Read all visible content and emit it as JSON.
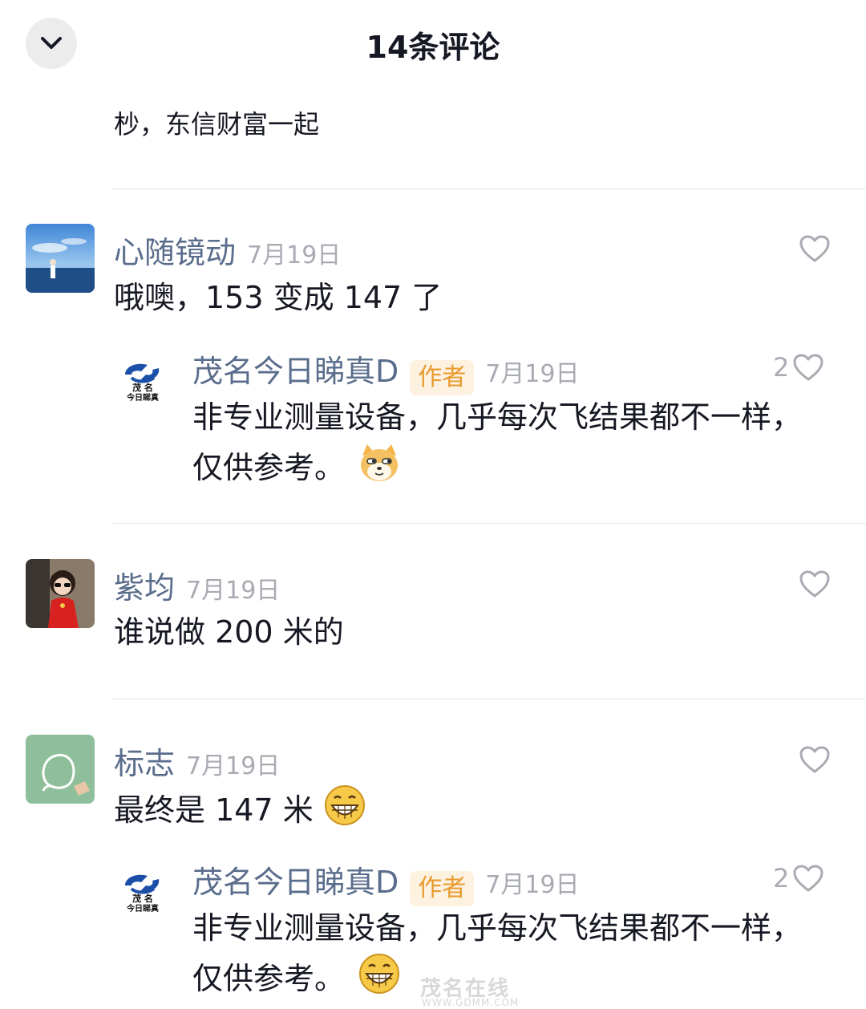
{
  "header": {
    "title": "14条评论"
  },
  "partial_comment": {
    "text": "杪，东信财富一起"
  },
  "comments": [
    {
      "name": "心随镜动",
      "date": "7月19日",
      "text": "哦噢，153 变成 147 了",
      "like_icon": "heart-outline",
      "reply": {
        "name": "茂名今日睇真D",
        "badge": "作者",
        "date": "7月19日",
        "likes": "2",
        "text_line1": "非专业测量设备，几乎每次飞结果都不一样，",
        "text_line2": "仅供参考。",
        "emoji": "doge-emoji",
        "logo_line1": "茂 名",
        "logo_line2": "今日睇真"
      }
    },
    {
      "name": "紫均",
      "date": "7月19日",
      "text": "谁说做 200 米的",
      "like_icon": "heart-outline"
    },
    {
      "name": "标志",
      "date": "7月19日",
      "text": "最终是 147 米",
      "emoji": "grin-emoji",
      "like_icon": "heart-outline",
      "reply": {
        "name": "茂名今日睇真D",
        "badge": "作者",
        "date": "7月19日",
        "likes": "2",
        "text_line1": "非专业测量设备，几乎每次飞结果都不一样，",
        "text_line2": "仅供参考。",
        "emoji": "grin-emoji",
        "logo_line1": "茂 名",
        "logo_line2": "今日睇真"
      }
    }
  ],
  "watermark": {
    "main": "茂名在线",
    "sub": "WWW.GDMM.COM"
  }
}
